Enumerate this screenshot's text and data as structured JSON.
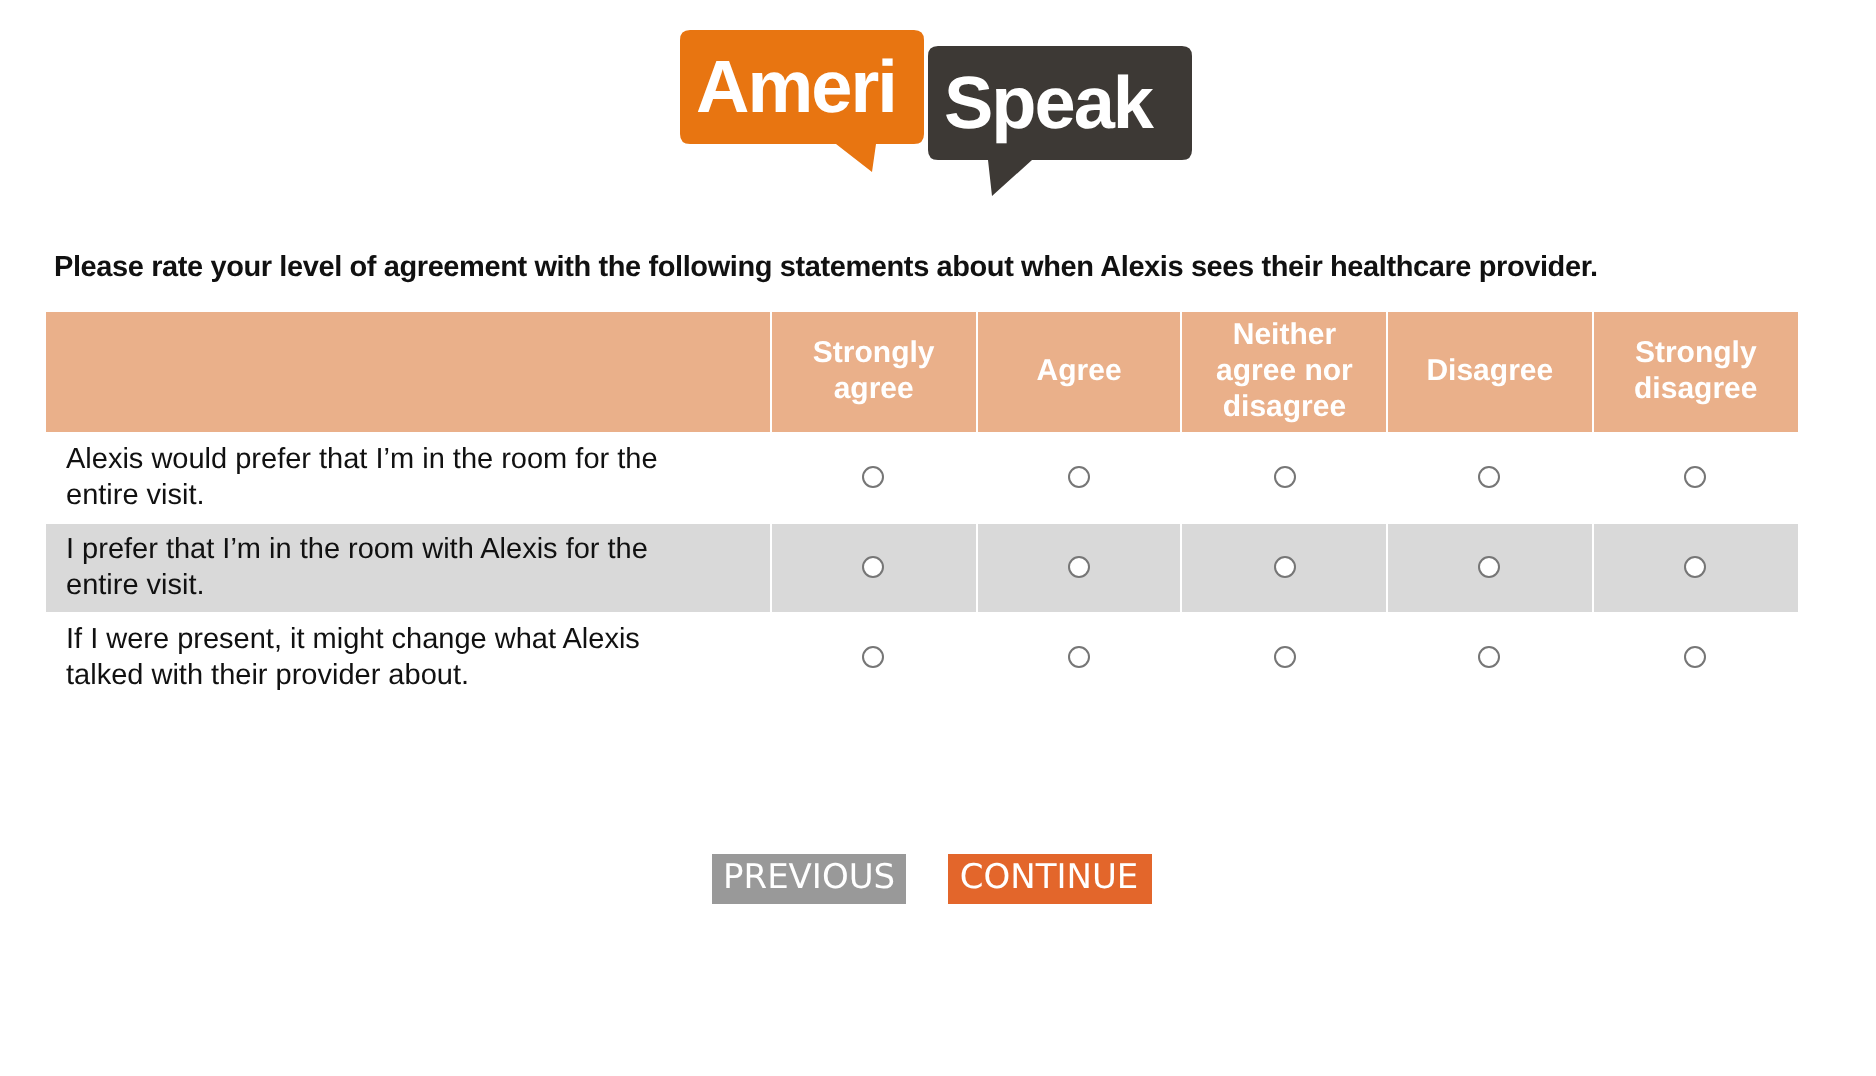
{
  "logo": {
    "part_1": "Ameri",
    "part_2": "Speak"
  },
  "question": "Please rate your level of agreement with the following statements about when Alexis sees their healthcare provider.",
  "columns": [
    "Strongly agree",
    "Agree",
    "Neither agree nor disagree",
    "Disagree",
    "Strongly disagree"
  ],
  "rows": [
    {
      "statement": "Alexis would prefer that I’m in the room for the entire visit.",
      "options": [
        {
          "selected": false
        },
        {
          "selected": false
        },
        {
          "selected": false
        },
        {
          "selected": false
        },
        {
          "selected": false
        }
      ]
    },
    {
      "statement": "I prefer that I’m in the room with Alexis for the entire visit.",
      "options": [
        {
          "selected": false
        },
        {
          "selected": false
        },
        {
          "selected": false
        },
        {
          "selected": false
        },
        {
          "selected": false
        }
      ]
    },
    {
      "statement": "If I were present, it might change what Alexis talked with their provider about.",
      "options": [
        {
          "selected": false
        },
        {
          "selected": false
        },
        {
          "selected": false
        },
        {
          "selected": false
        },
        {
          "selected": false
        }
      ]
    }
  ],
  "buttons": {
    "previous": "PREVIOUS",
    "continue": "CONTINUE"
  }
}
